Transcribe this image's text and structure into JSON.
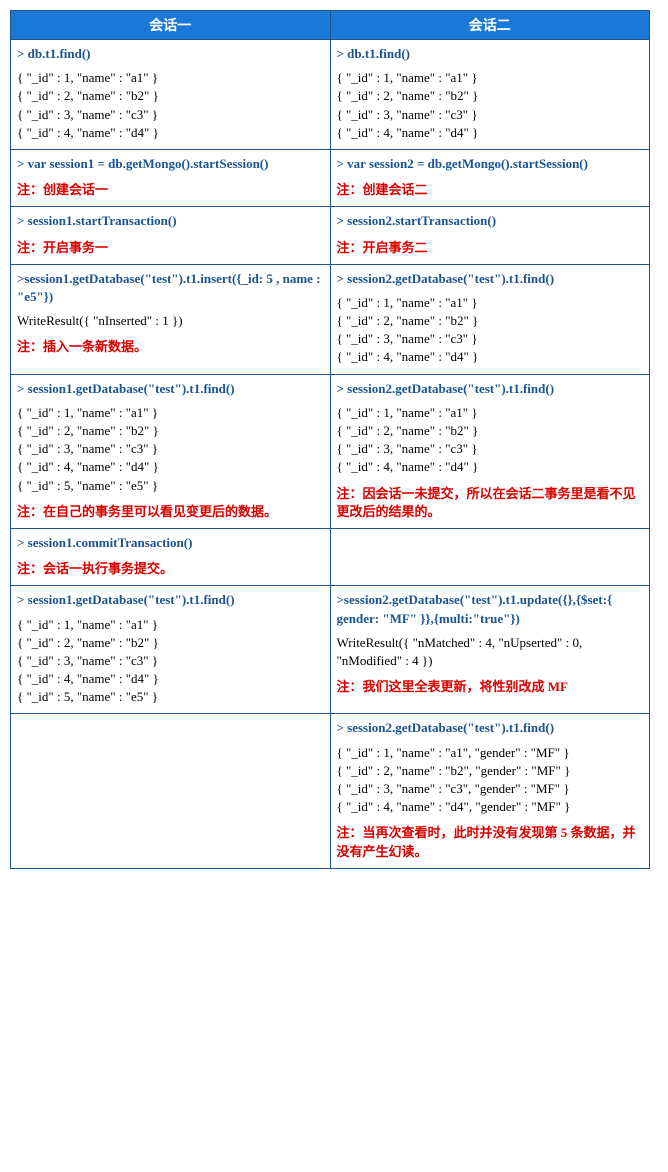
{
  "headers": {
    "col1": "会话一",
    "col2": "会话二"
  },
  "rows": [
    {
      "left": {
        "cmd": "> db.t1.find()",
        "out": "{ \"_id\" : 1, \"name\" : \"a1\" }\n{ \"_id\" : 2, \"name\" : \"b2\" }\n{ \"_id\" : 3, \"name\" : \"c3\" }\n{ \"_id\" : 4, \"name\" : \"d4\" }",
        "note": ""
      },
      "right": {
        "cmd": "> db.t1.find()",
        "out": "{ \"_id\" : 1, \"name\" : \"a1\" }\n{ \"_id\" : 2, \"name\" : \"b2\" }\n{ \"_id\" : 3, \"name\" : \"c3\" }\n{ \"_id\" : 4, \"name\" : \"d4\" }",
        "note": ""
      }
    },
    {
      "left": {
        "cmd": "> var session1 = db.getMongo().startSession()",
        "out": "",
        "note": "注：创建会话一"
      },
      "right": {
        "cmd": "> var session2 = db.getMongo().startSession()",
        "out": "",
        "note": "注：创建会话二"
      }
    },
    {
      "left": {
        "cmd": "> session1.startTransaction()",
        "out": "",
        "note": "注：开启事务一"
      },
      "right": {
        "cmd": "> session2.startTransaction()",
        "out": "",
        "note": "注：开启事务二"
      }
    },
    {
      "left": {
        "cmd": ">session1.getDatabase(\"test\").t1.insert({_id: 5 , name : \"e5\"})",
        "out": "WriteResult({ \"nInserted\" : 1 })",
        "note": "注：插入一条新数据。"
      },
      "right": {
        "cmd": "> session2.getDatabase(\"test\").t1.find()",
        "out": "{ \"_id\" : 1, \"name\" : \"a1\" }\n{ \"_id\" : 2, \"name\" : \"b2\" }\n{ \"_id\" : 3, \"name\" : \"c3\" }\n{ \"_id\" : 4, \"name\" : \"d4\" }",
        "note": ""
      }
    },
    {
      "left": {
        "cmd": "> session1.getDatabase(\"test\").t1.find()",
        "out": "{ \"_id\" : 1, \"name\" : \"a1\" }\n{ \"_id\" : 2, \"name\" : \"b2\" }\n{ \"_id\" : 3, \"name\" : \"c3\" }\n{ \"_id\" : 4, \"name\" : \"d4\" }\n{ \"_id\" : 5, \"name\" : \"e5\" }",
        "note": "注：在自己的事务里可以看见变更后的数据。"
      },
      "right": {
        "cmd": "> session2.getDatabase(\"test\").t1.find()",
        "out": "{ \"_id\" : 1, \"name\" : \"a1\" }\n{ \"_id\" : 2, \"name\" : \"b2\" }\n{ \"_id\" : 3, \"name\" : \"c3\" }\n{ \"_id\" : 4, \"name\" : \"d4\" }",
        "note": "注：因会话一未提交，所以在会话二事务里是看不见更改后的结果的。"
      }
    },
    {
      "left": {
        "cmd": "> session1.commitTransaction()",
        "out": "",
        "note": "注：会话一执行事务提交。"
      },
      "right": {
        "cmd": "",
        "out": "",
        "note": ""
      }
    },
    {
      "left": {
        "cmd": "> session1.getDatabase(\"test\").t1.find()",
        "out": "{ \"_id\" : 1, \"name\" : \"a1\" }\n{ \"_id\" : 2, \"name\" : \"b2\" }\n{ \"_id\" : 3, \"name\" : \"c3\" }\n{ \"_id\" : 4, \"name\" : \"d4\" }\n{ \"_id\" : 5, \"name\" : \"e5\" }",
        "note": ""
      },
      "right": {
        "cmd": ">session2.getDatabase(\"test\").t1.update({},{$set:{ gender: \"MF\" }},{multi:\"true\"})",
        "out": "WriteResult({ \"nMatched\" : 4, \"nUpserted\" : 0, \"nModified\" : 4 })",
        "note": "注：我们这里全表更新，将性别改成 MF"
      }
    },
    {
      "left": {
        "cmd": "",
        "out": "",
        "note": ""
      },
      "right": {
        "cmd": "> session2.getDatabase(\"test\").t1.find()",
        "out": "{ \"_id\" : 1, \"name\" : \"a1\", \"gender\" : \"MF\" }\n{ \"_id\" : 2, \"name\" : \"b2\", \"gender\" : \"MF\" }\n{ \"_id\" : 3, \"name\" : \"c3\", \"gender\" : \"MF\" }\n{ \"_id\" : 4, \"name\" : \"d4\", \"gender\" : \"MF\" }",
        "note": "注：当再次查看时，此时并没有发现第 5 条数据，并没有产生幻读。"
      }
    }
  ]
}
